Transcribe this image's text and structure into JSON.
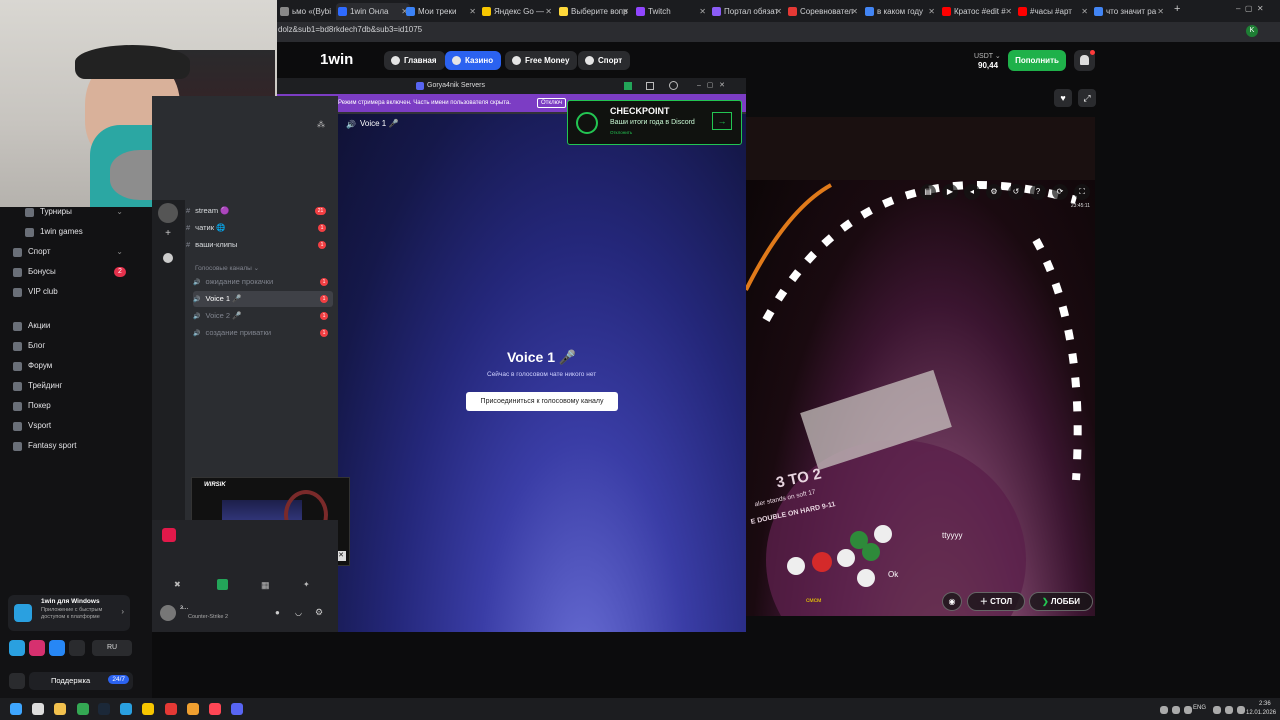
{
  "browser": {
    "tabs": [
      {
        "label": "ьмо «(Bybi",
        "color": "#888"
      },
      {
        "label": "1win Онлa",
        "color": "#2f6bff"
      },
      {
        "label": "Мои треки",
        "color": "#3b82f6"
      },
      {
        "label": "Яндекс Go —",
        "color": "#f7c600"
      },
      {
        "label": "Выберите вопр",
        "color": "#ffd93b"
      },
      {
        "label": "Twitch",
        "color": "#9146ff"
      },
      {
        "label": "Портал обязат",
        "color": "#8b5cf6"
      },
      {
        "label": "Соревновател",
        "color": "#e53935"
      },
      {
        "label": "в каком году",
        "color": "#4285f4"
      },
      {
        "label": "Кратос #edit #",
        "color": "#ff0000"
      },
      {
        "label": "#часы #арт",
        "color": "#ff0000"
      },
      {
        "label": "что значит ра",
        "color": "#4285f4"
      }
    ],
    "new_tab": "+",
    "url": "dolz&sub1=bd8rkdech7db&sub3=id1075"
  },
  "site": {
    "logo": "1win",
    "nav": [
      "Главная",
      "Казино",
      "Free Money",
      "Спорт"
    ],
    "balance_currency": "USDT ⌄",
    "balance": "90,44",
    "deposit": "Пополнить",
    "sidebar": [
      {
        "label": "Турниры",
        "badge": "",
        "chev": true
      },
      {
        "label": "1win games",
        "badge": "",
        "chev": false
      },
      {
        "label": "Спорт",
        "badge": "",
        "chev": true
      },
      {
        "label": "Бонусы",
        "badge": "2",
        "chev": false
      },
      {
        "label": "VIP club",
        "badge": "",
        "chev": false
      },
      {
        "label": "Акции",
        "badge": "",
        "chev": false
      },
      {
        "label": "Блог",
        "badge": "",
        "chev": false
      },
      {
        "label": "Форум",
        "badge": "",
        "chev": false
      },
      {
        "label": "Трейдинг",
        "badge": "",
        "chev": false
      },
      {
        "label": "Покер",
        "badge": "",
        "chev": false
      },
      {
        "label": "Vsport",
        "badge": "",
        "chev": false
      },
      {
        "label": "Fantasy sport",
        "badge": "",
        "chev": false
      }
    ],
    "app_promo_title": "1win для Windows",
    "app_promo_text": "Приложение с быстрым доступом к платформе",
    "lang": "RU",
    "support": "Поддержка",
    "support_badge": "24/7"
  },
  "discord": {
    "window_title": "Gorya4nik Servers",
    "streamer_notice": "Режим стримера включен. Часть имени пользователя скрыта.",
    "streamer_btn": "Отключ",
    "checkpoint_title": "CHECKPOINT",
    "checkpoint_text": "Ваши итоги года в Discord",
    "checkpoint_link": "Отклонить",
    "header_channel": "Voice 1 🎤",
    "text_channels": [
      {
        "name": "stream 🟣",
        "badge": "21"
      },
      {
        "name": "чатик 🌐",
        "badge": "1"
      },
      {
        "name": "ваши-клипы",
        "badge": "1"
      }
    ],
    "voice_category": "Голосовые каналы ⌄",
    "voice_channels": [
      {
        "name": "ожидание прокачки",
        "badge": "1"
      },
      {
        "name": "Voice 1 🎤",
        "badge": "1"
      },
      {
        "name": "Voice 2 🎤",
        "badge": "1"
      },
      {
        "name": "создание приватки",
        "badge": "1"
      }
    ],
    "voice_title": "Voice 1 🎤",
    "voice_sub": "Сейчас в голосовом чате никого нет",
    "join_button": "Присоединиться к голосовому каналу",
    "user_status": "Counter-Strike 2",
    "user_name": "з...",
    "preview_label": "WIRSIK"
  },
  "casino": {
    "table_text": "3 TO 2",
    "table_sub": "aler stands on soft 17",
    "table_sub2": "E DOUBLE ON HARD 9-11",
    "chat1": "ttyyyy",
    "chat2": "Ok",
    "player": "смсм",
    "time": "23:45:11",
    "btn_table": "СТОЛ",
    "btn_lobby": "ЛОББИ"
  },
  "taskbar": {
    "lang": "ENG",
    "time": "2:36",
    "date": "12.01.2026"
  }
}
